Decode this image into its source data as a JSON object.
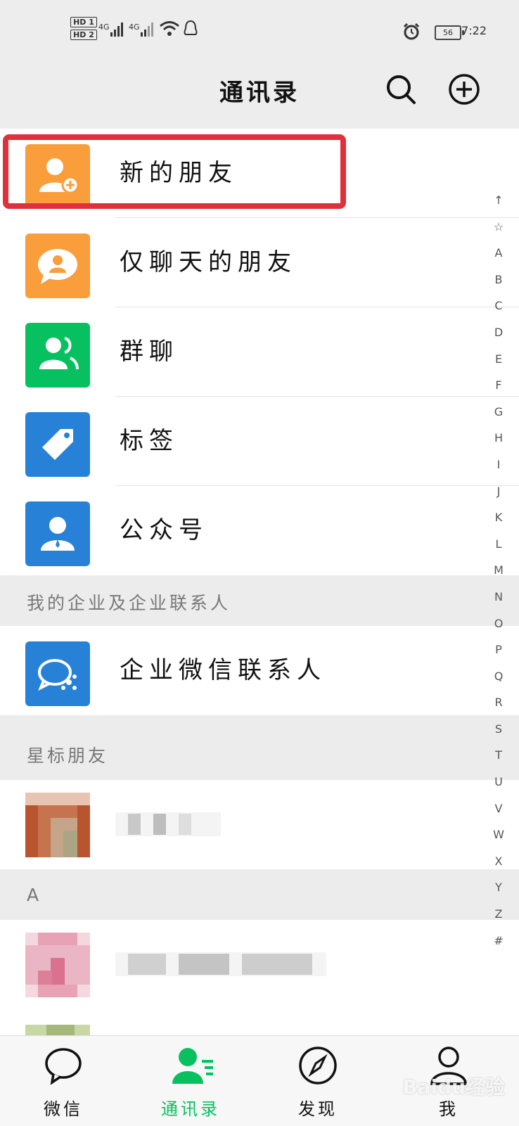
{
  "status_bar": {
    "hd1": "HD 1",
    "hd2": "HD 2",
    "net1": "4G",
    "net2": "4G",
    "battery": "56",
    "time": "7:22"
  },
  "header": {
    "title": "通讯录",
    "icons": [
      "search-icon",
      "add-circle-icon"
    ]
  },
  "menu": [
    {
      "label": "新的朋友",
      "icon": "add-friend-icon",
      "color": "#fa9d3b"
    },
    {
      "label": "仅聊天的朋友",
      "icon": "chat-only-icon",
      "color": "#fa9d3b"
    },
    {
      "label": "群聊",
      "icon": "group-chat-icon",
      "color": "#07c160"
    },
    {
      "label": "标签",
      "icon": "tag-icon",
      "color": "#2782d7"
    },
    {
      "label": "公众号",
      "icon": "official-account-icon",
      "color": "#2782d7"
    }
  ],
  "sections": {
    "enterprise": "我的企业及企业联系人",
    "starred": "星标朋友",
    "a": "A"
  },
  "enterprise_item": {
    "label": "企业微信联系人",
    "icon": "wecom-icon",
    "color": "#2782d7"
  },
  "index_bar": [
    "↑",
    "☆",
    "A",
    "B",
    "C",
    "D",
    "E",
    "F",
    "G",
    "H",
    "I",
    "J",
    "K",
    "L",
    "M",
    "N",
    "O",
    "P",
    "Q",
    "R",
    "S",
    "T",
    "U",
    "V",
    "W",
    "X",
    "Y",
    "Z",
    "#"
  ],
  "tabs": [
    {
      "label": "微信",
      "icon": "chat-icon",
      "active": false
    },
    {
      "label": "通讯录",
      "icon": "contacts-icon",
      "active": true
    },
    {
      "label": "发现",
      "icon": "compass-icon",
      "active": false
    },
    {
      "label": "我",
      "icon": "me-icon",
      "active": false
    }
  ],
  "colors": {
    "accent": "#07c160",
    "highlight": "#e0303c"
  },
  "watermark": "Baidu经验"
}
